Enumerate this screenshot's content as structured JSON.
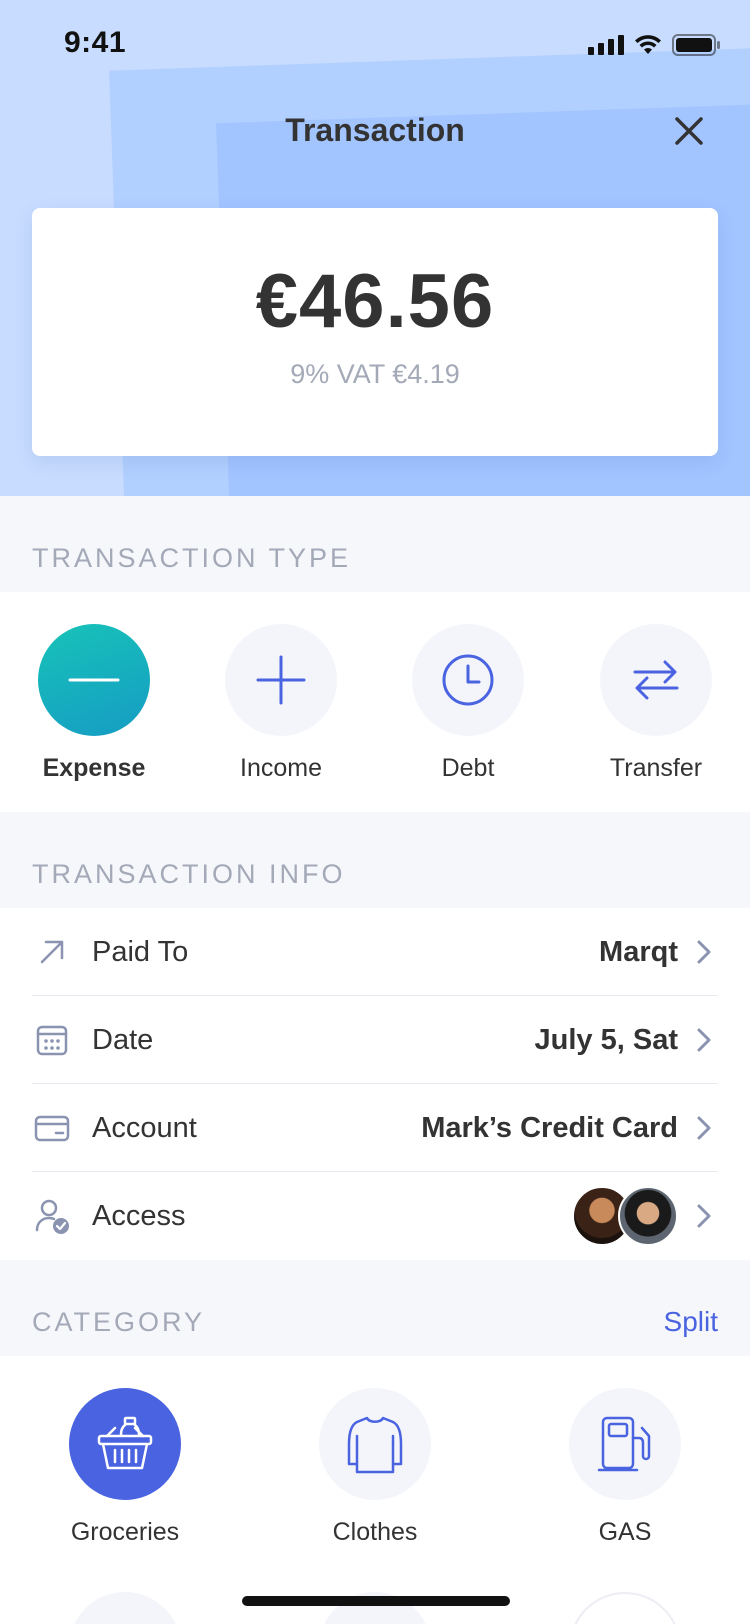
{
  "status_bar": {
    "time": "9:41"
  },
  "header": {
    "title": "Transaction"
  },
  "amount": {
    "value": "€46.56",
    "vat": "9% VAT €4.19"
  },
  "transaction_type": {
    "heading": "TRANSACTION TYPE",
    "items": [
      {
        "label": "Expense",
        "icon": "minus-icon",
        "active": true
      },
      {
        "label": "Income",
        "icon": "plus-icon",
        "active": false
      },
      {
        "label": "Debt",
        "icon": "clock-icon",
        "active": false
      },
      {
        "label": "Transfer",
        "icon": "transfer-arrows-icon",
        "active": false
      }
    ]
  },
  "transaction_info": {
    "heading": "TRANSACTION INFO",
    "rows": [
      {
        "label": "Paid To",
        "value": "Marqt",
        "icon": "arrow-up-right-icon"
      },
      {
        "label": "Date",
        "value": "July 5, Sat",
        "icon": "calendar-icon"
      },
      {
        "label": "Account",
        "value": "Mark’s Credit Card",
        "icon": "credit-card-icon"
      },
      {
        "label": "Access",
        "value": "",
        "icon": "user-check-icon"
      }
    ]
  },
  "category": {
    "heading": "CATEGORY",
    "split_label": "Split",
    "items": [
      {
        "label": "Groceries",
        "icon": "grocery-basket-icon",
        "active": true
      },
      {
        "label": "Clothes",
        "icon": "shirt-icon",
        "active": false
      },
      {
        "label": "GAS",
        "icon": "gas-pump-icon",
        "active": false
      }
    ]
  },
  "colors": {
    "accent": "#4a63e0",
    "teal": "#17b3bd",
    "header_bg": "#a7c8ff",
    "muted_text": "#a4a9b8"
  }
}
